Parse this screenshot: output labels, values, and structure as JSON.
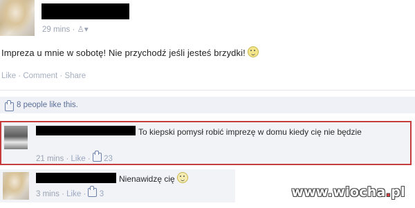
{
  "post": {
    "time": "29 mins",
    "audience_icon": "friends-icon",
    "text": "Impreza u mnie w sobotę! Nie przychodź jeśli jesteś brzydki!",
    "actions": {
      "like": "Like",
      "comment": "Comment",
      "share": "Share",
      "separator": "·"
    },
    "likes_text": "8 people like this."
  },
  "comments": [
    {
      "text": "To kiepski pomysł robić imprezę w domu kiedy cię nie będzie",
      "time": "21 mins",
      "like": "Like",
      "like_count": "23",
      "highlighted": true
    },
    {
      "text": "Nienawidzę cię",
      "time": "3 mins",
      "like": "Like",
      "like_count": "3",
      "highlighted": false
    }
  ],
  "watermark": {
    "prefix": "www.",
    "brand": "wiocha",
    "dot": ".",
    "suffix": "pl"
  },
  "colors": {
    "highlight_border": "#c63c3c",
    "link": "#9aa6c1",
    "likes_bar": "#eff1f6"
  }
}
